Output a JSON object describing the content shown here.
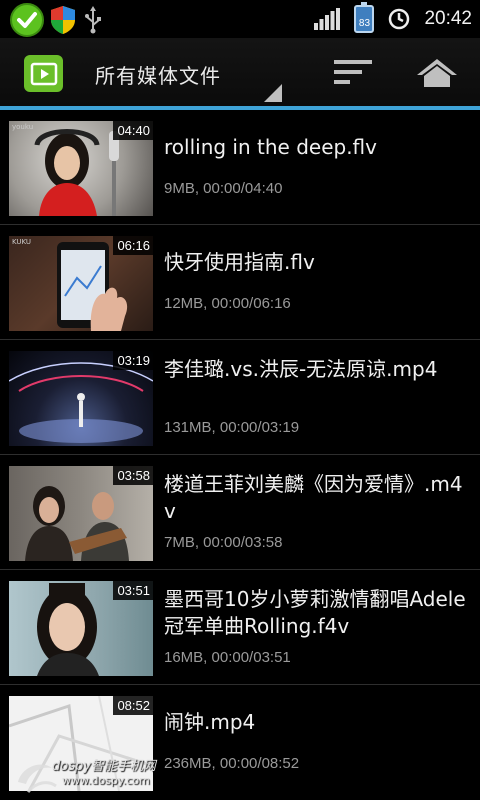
{
  "status_bar": {
    "battery_level": "83",
    "time": "20:42",
    "icons": [
      "check-icon",
      "shield-icon",
      "usb-icon",
      "signal-icon",
      "battery-icon",
      "clock-icon"
    ]
  },
  "action_bar": {
    "title": "所有媒体文件",
    "icons": [
      "video-app-icon",
      "dropdown-triangle-icon",
      "sort-icon",
      "home-icon"
    ],
    "accent_color": "#3fa4d8"
  },
  "videos": [
    {
      "name": "rolling in the deep.flv",
      "duration": "04:40",
      "meta": "9MB, 00:00/04:40",
      "thumb_label": "youku"
    },
    {
      "name": "快牙使用指南.flv",
      "duration": "06:16",
      "meta": "12MB, 00:00/06:16",
      "thumb_label": "KUKU"
    },
    {
      "name": "李佳璐.vs.洪辰-无法原谅.mp4",
      "duration": "03:19",
      "meta": "131MB, 00:00/03:19"
    },
    {
      "name": "楼道王菲刘美麟《因为爱情》.m4v",
      "duration": "03:58",
      "meta": "7MB, 00:00/03:58"
    },
    {
      "name": "墨西哥10岁小萝莉激情翻唱Adele冠军单曲Rolling.f4v",
      "duration": "03:51",
      "meta": "16MB, 00:00/03:51"
    },
    {
      "name": "闹钟.mp4",
      "duration": "08:52",
      "meta": "236MB, 00:00/08:52"
    }
  ],
  "watermark": {
    "brand": "dospy智能手机网",
    "url": "www.dospy.com"
  }
}
